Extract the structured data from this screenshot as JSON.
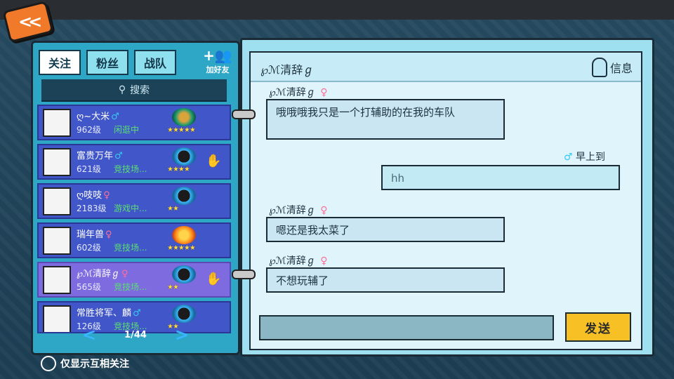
{
  "tabs": [
    "关注",
    "粉丝",
    "战队"
  ],
  "add_friend": "加好友",
  "search_label": "搜索",
  "friends": [
    {
      "name": "ღ~大米",
      "gender": "♂",
      "level": "962级",
      "status": "闲逛中",
      "stars": "★★★★★",
      "badge": "green"
    },
    {
      "name": "富贵万年",
      "gender": "♂",
      "level": "621级",
      "status": "竞技场...",
      "stars": "★★★★",
      "badge": "blue"
    },
    {
      "name": "ღ吱吱",
      "gender": "♀",
      "level": "2183级",
      "status": "游戏中...",
      "stars": "★★",
      "badge": "blue"
    },
    {
      "name": "瑞年兽",
      "gender": "♀",
      "level": "602级",
      "status": "竞技场...",
      "stars": "★★★★★",
      "badge": "gold"
    },
    {
      "name": "℘ℳ清辞ℊ",
      "gender": "♀",
      "level": "565级",
      "status": "竞技场...",
      "stars": "★★",
      "badge": "blue"
    },
    {
      "name": "常胜将军、麟",
      "gender": "♂",
      "level": "126级",
      "status": "竞技场...",
      "stars": "★★",
      "badge": "blue"
    }
  ],
  "pager": "1/44",
  "mutual_label": "仅显示互相关注",
  "chat": {
    "title": "℘ℳ清辞ℊ",
    "info": "信息",
    "messages": [
      {
        "sender": "℘ℳ清辞ℊ",
        "gender": "♀",
        "text": "哦哦哦我只是一个打辅助的在我的车队"
      },
      {
        "sender": "早上到",
        "gender": "♂",
        "text": "hh"
      },
      {
        "sender": "℘ℳ清辞ℊ",
        "gender": "♀",
        "text": "嗯还是我太菜了"
      },
      {
        "sender": "℘ℳ清辞ℊ",
        "gender": "♀",
        "text": "不想玩辅了"
      }
    ],
    "input_value": "",
    "send": "发送"
  },
  "colors": {
    "accent": "#2ea6c6",
    "send": "#f7c126",
    "online": "#59e06f"
  }
}
